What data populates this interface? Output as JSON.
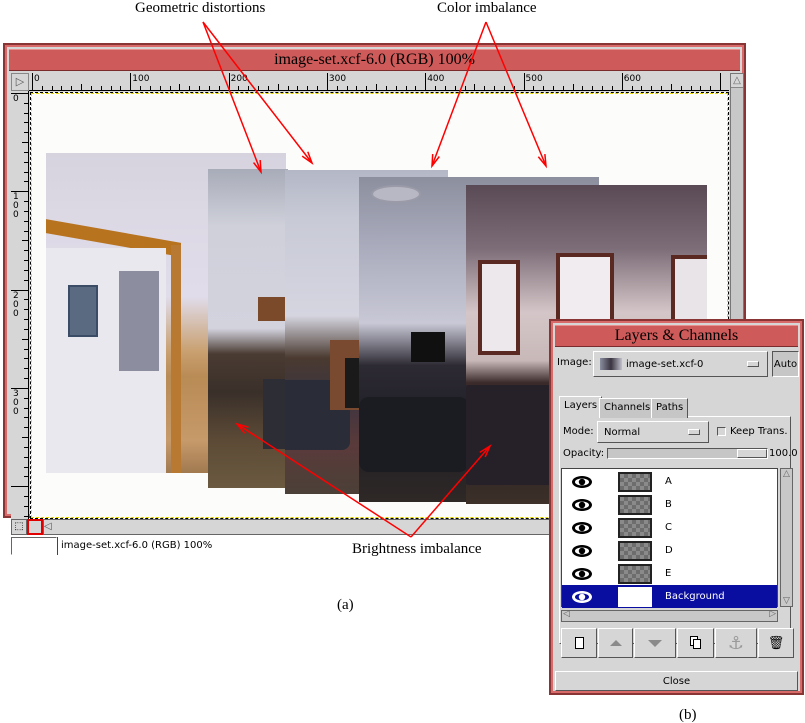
{
  "annotations": {
    "geometric": "Geometric distortions",
    "color": "Color imbalance",
    "brightness": "Brightness imbalance",
    "arrow_color": "#ff0000"
  },
  "figure_labels": {
    "a": "(a)",
    "b": "(b)"
  },
  "image_window": {
    "title": "image-set.xcf-6.0 (RGB) 100%",
    "ruler_h_labels": [
      "0",
      "100",
      "200",
      "300",
      "400",
      "500",
      "600"
    ],
    "ruler_v_labels": [
      "0",
      "100",
      "200",
      "300"
    ],
    "status_text": "image-set.xcf-6.0 (RGB) 100%",
    "title_color": "#cf5a5a",
    "layers": [
      {
        "name": "E",
        "tone": "bright-warm"
      },
      {
        "name": "D",
        "tone": "grey-dim"
      },
      {
        "name": "C",
        "tone": "blue-grey"
      },
      {
        "name": "B",
        "tone": "dark-blue"
      },
      {
        "name": "A",
        "tone": "dark-purple"
      }
    ]
  },
  "layers_dialog": {
    "title": "Layers & Channels",
    "image_label": "Image:",
    "image_value": "image-set.xcf-0",
    "auto_label": "Auto",
    "tabs": [
      "Layers",
      "Channels",
      "Paths"
    ],
    "active_tab": "Layers",
    "mode_label": "Mode:",
    "mode_value": "Normal",
    "keep_trans_label": "Keep Trans.",
    "keep_trans_checked": false,
    "opacity_label": "Opacity:",
    "opacity_value": "100.0",
    "opacity_fraction": 1.0,
    "layers": [
      {
        "name": "A",
        "visible": true,
        "selected": false
      },
      {
        "name": "B",
        "visible": true,
        "selected": false
      },
      {
        "name": "C",
        "visible": true,
        "selected": false
      },
      {
        "name": "D",
        "visible": true,
        "selected": false
      },
      {
        "name": "E",
        "visible": true,
        "selected": false
      },
      {
        "name": "Background",
        "visible": true,
        "selected": true
      }
    ],
    "selected_color": "#0a0ea0",
    "toolbar": [
      "new-layer",
      "raise-layer",
      "lower-layer",
      "duplicate-layer",
      "anchor-layer",
      "delete-layer"
    ],
    "close_label": "Close"
  }
}
